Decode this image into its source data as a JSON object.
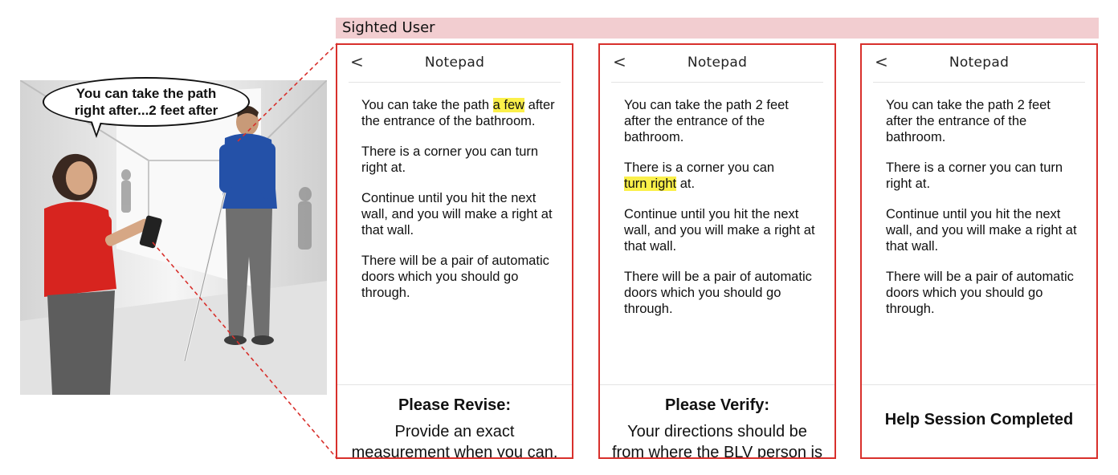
{
  "banner": {
    "label": "Sighted User"
  },
  "illustration": {
    "speech": [
      "You can take the path",
      "right after...2 feet after"
    ]
  },
  "colors": {
    "accent_red": "#d8302c",
    "highlight": "#fbf04a",
    "banner_bg": "#f2cdd0"
  },
  "phones": [
    {
      "title": "Notepad",
      "back": "<",
      "paragraphs": {
        "p1_pre": "You can take the  path",
        "p1_hl": "a few",
        "p1_post": "after the entrance of the bathroom.",
        "p2_pre": "There is a corner you can turn right at.",
        "p3": "Continue until you hit the next wall, and you will make a right at that wall.",
        "p4": "There will be a pair of automatic doors which you should go through."
      },
      "message": {
        "title": "Please Revise:",
        "text": "Provide an exact measurement when you can."
      }
    },
    {
      "title": "Notepad",
      "back": "<",
      "paragraphs": {
        "p1": "You can take the path 2 feet after the entrance of the bathroom.",
        "p2_pre": "There is a corner you can",
        "p2_hl": "turn right",
        "p2_post": "at.",
        "p3": "Continue until you hit the next wall, and you will make a right at that wall.",
        "p4": "There will be a pair of automatic doors which you should go through."
      },
      "message": {
        "title": "Please Verify:",
        "text": "Your directions should be from where the BLV person is facing."
      }
    },
    {
      "title": "Notepad",
      "back": "<",
      "paragraphs": {
        "p1": "You can take the path 2 feet after the entrance of the bathroom.",
        "p2": "There is a corner you can turn right at.",
        "p3": "Continue until you hit the next wall, and you will make a right at that wall.",
        "p4": "There will be a pair of automatic doors which you should go through."
      },
      "message": {
        "title": "Help Session Completed"
      }
    }
  ]
}
